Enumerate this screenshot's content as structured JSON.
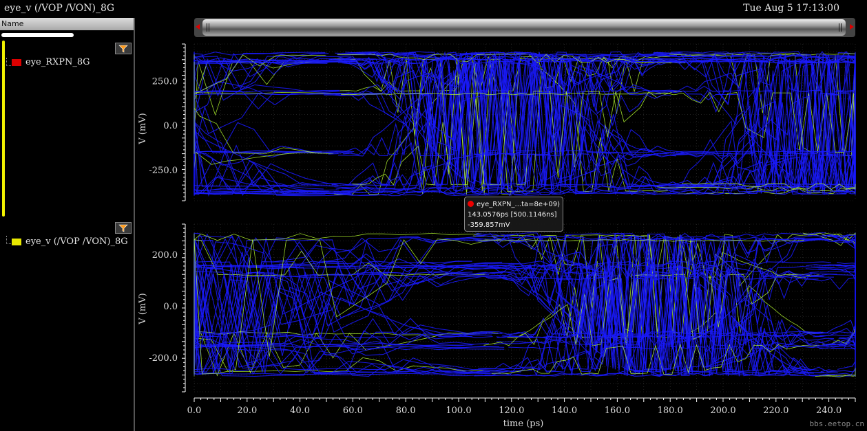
{
  "window": {
    "title": "eye_v (/VOP /VON)_8G",
    "timestamp": "Tue Aug 5 17:13:00"
  },
  "panel": {
    "header": "Name",
    "signals": [
      {
        "name": "eye_RXPN_8G",
        "color": "#dd0000"
      },
      {
        "name": "eye_v (/VOP /VON)_8G",
        "color": "#e8e800"
      }
    ]
  },
  "tooltip": {
    "title": "eye_RXPN_...ta=8e+09)",
    "line1": "143.0576ps [500.1146ns]",
    "line2": "-359.857mV"
  },
  "watermark": "bbs.eetop.cn",
  "icons": {
    "filter": "filter-icon",
    "marker": "marker-dot-icon"
  },
  "colors": {
    "trace": "#1a1aff",
    "trace_highlight": "#b8ff30",
    "axis": "#ffffff",
    "grid": "#3a3a3a"
  },
  "chart_data": [
    {
      "type": "line",
      "title": "",
      "series_name": "eye_RXPN_8G",
      "xlabel": "time (ps)",
      "ylabel": "V (mV)",
      "xlim": [
        0,
        250
      ],
      "ylim": [
        -420,
        460
      ],
      "yticks": [
        250.0,
        0.0,
        -250.0
      ],
      "ytick_labels": [
        "250.0",
        "0.0",
        "-250.0"
      ],
      "unit_interval_ps": 125,
      "crossing_times_ps": [
        55,
        180
      ],
      "levels_mV": [
        400,
        365,
        185,
        -155,
        -340,
        -375
      ],
      "grid": true
    },
    {
      "type": "line",
      "title": "",
      "series_name": "eye_v (/VOP /VON)_8G",
      "xlabel": "time (ps)",
      "ylabel": "V (mV)",
      "xlim": [
        0,
        250
      ],
      "ylim": [
        -330,
        320
      ],
      "yticks": [
        200.0,
        0.0,
        -200.0
      ],
      "ytick_labels": [
        "200.0",
        "0.0",
        "-200.0"
      ],
      "xticks": [
        0.0,
        20.0,
        40.0,
        60.0,
        80.0,
        100.0,
        120.0,
        140.0,
        160.0,
        180.0,
        200.0,
        220.0,
        240.0
      ],
      "xtick_labels": [
        "0.0",
        "20.0",
        "40.0",
        "60.0",
        "80.0",
        "100.0",
        "120.0",
        "140.0",
        "160.0",
        "180.0",
        "200.0",
        "220.0",
        "240.0"
      ],
      "unit_interval_ps": 125,
      "crossing_times_ps": [
        112,
        237
      ],
      "levels_mV": [
        270,
        160,
        120,
        -110,
        -150,
        -255
      ],
      "grid": true
    }
  ]
}
